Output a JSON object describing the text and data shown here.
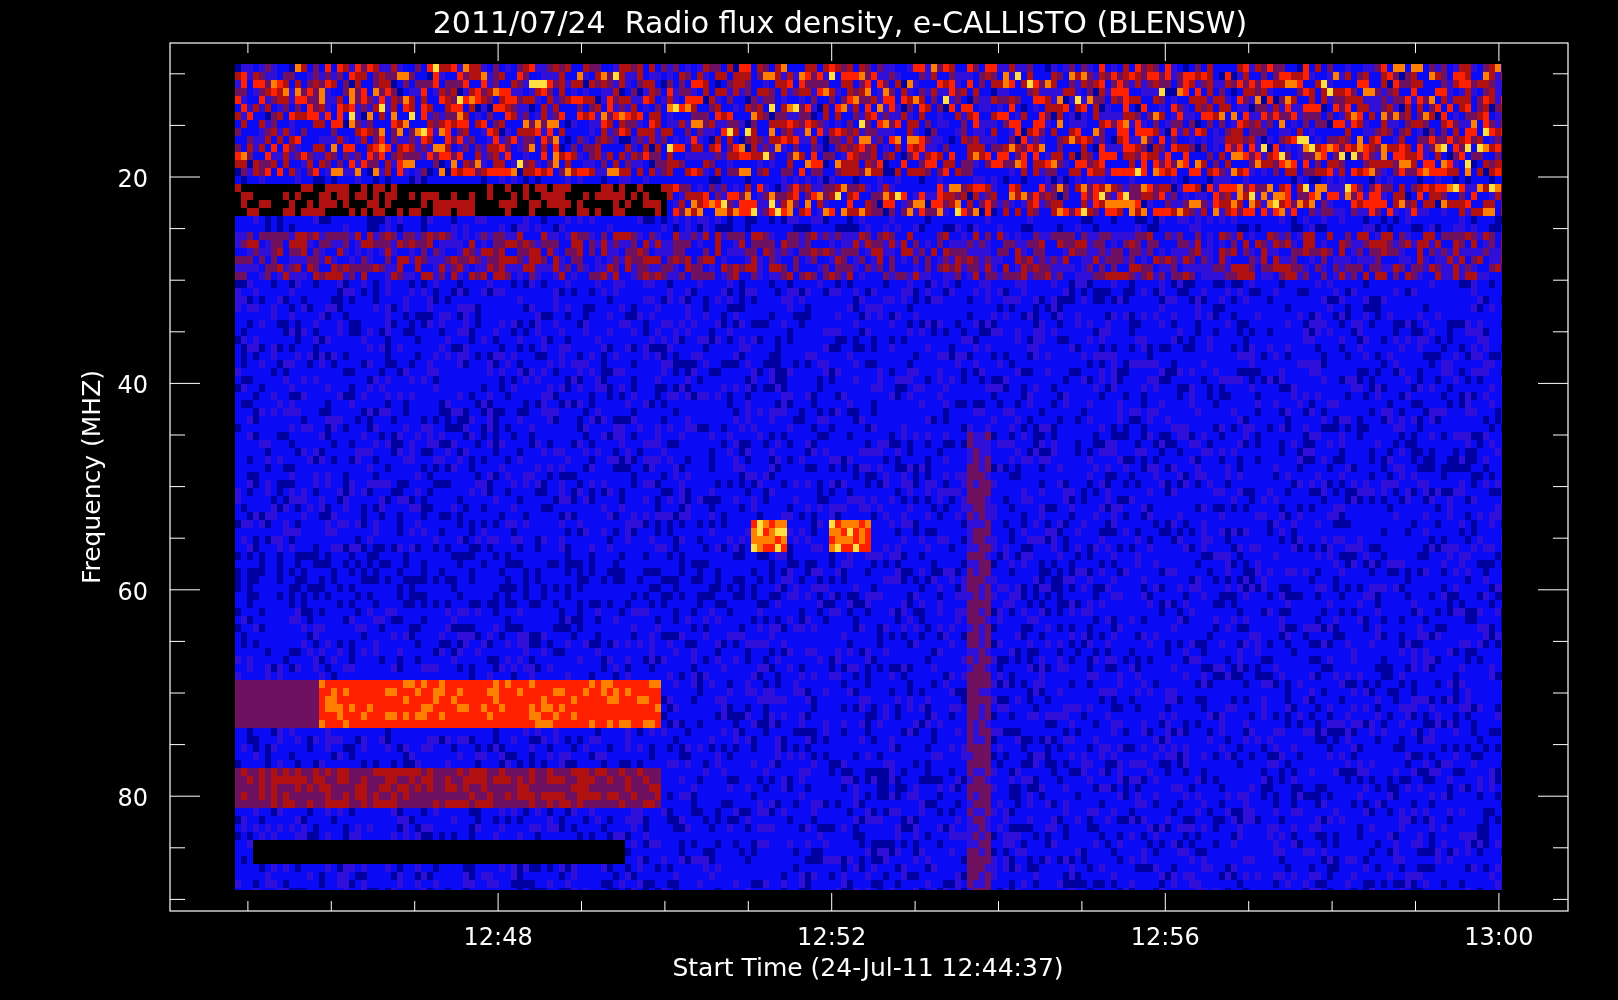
{
  "title": "2011/07/24  Radio flux density, e-CALLISTO (BLENSW)",
  "y_axis": {
    "label": "Frequency (MHZ)",
    "ticks": [
      "20",
      "40",
      "60",
      "80"
    ]
  },
  "x_axis": {
    "label": "Start Time (24-Jul-11 12:44:37)",
    "ticks": [
      "12:48",
      "12:52",
      "12:56",
      "13:00"
    ]
  }
}
